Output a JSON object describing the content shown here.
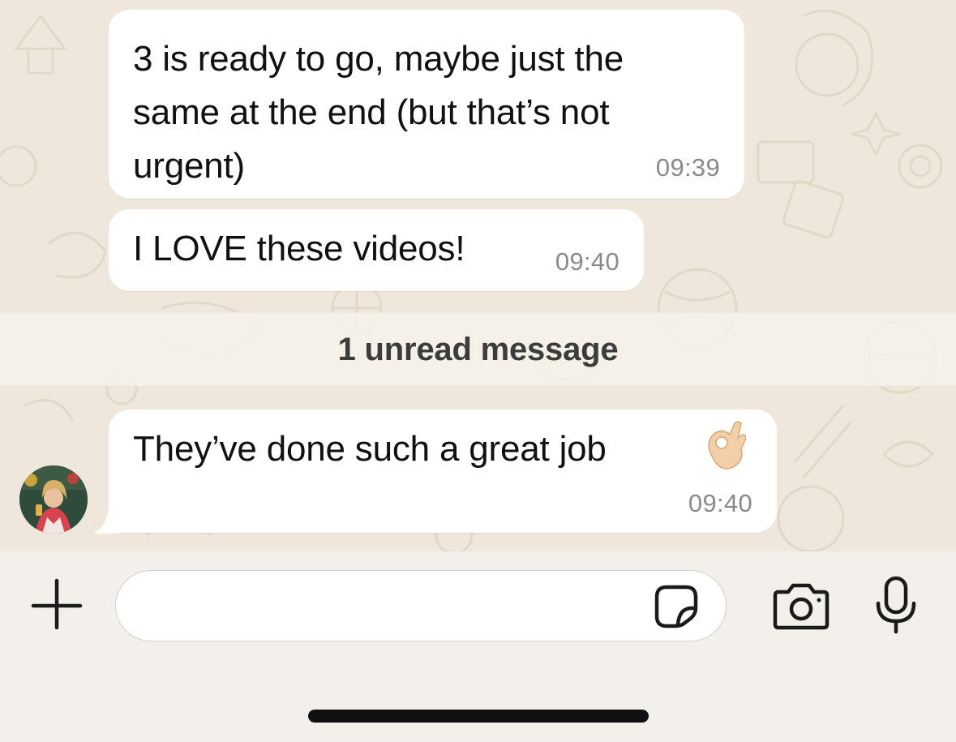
{
  "messages": [
    {
      "text": "3 is ready to go, maybe just the\nsame at the end (but that’s not\nurgent)",
      "time": "09:39"
    },
    {
      "text": "I LOVE these videos!",
      "time": "09:40"
    },
    {
      "text": "They’ve done such a great job",
      "emoji": "ok-hand-emoji",
      "time": "09:40"
    }
  ],
  "unread_divider": {
    "label": "1 unread message"
  },
  "input_bar": {
    "message_value": "",
    "icons": {
      "attach": "plus-icon",
      "sticker": "sticker-icon",
      "camera": "camera-icon",
      "microphone": "microphone-icon"
    }
  },
  "colors": {
    "wallpaper": "#efe7dc",
    "bubble": "#ffffff",
    "timestamp": "#8a8a8a",
    "input_bar": "#f3f0eb"
  }
}
